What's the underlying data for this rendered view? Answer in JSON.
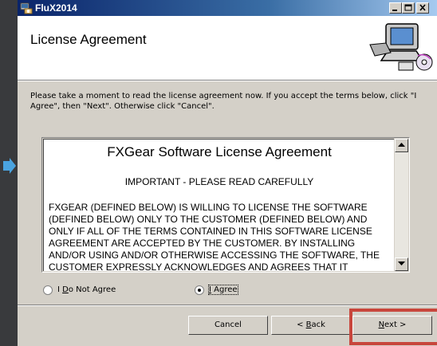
{
  "window": {
    "title": "FluX2014"
  },
  "header": {
    "title": "License Agreement"
  },
  "intro": "Please take a moment to read the license agreement now. If you accept the terms below, click \"I Agree\", then \"Next\". Otherwise click \"Cancel\".",
  "license": {
    "heading": "FXGear Software License Agreement",
    "subheading": "IMPORTANT - PLEASE READ CAREFULLY",
    "body": "FXGEAR (DEFINED BELOW) IS WILLING TO LICENSE THE SOFTWARE (DEFINED BELOW) ONLY TO THE CUSTOMER (DEFINED BELOW) AND ONLY IF ALL OF THE TERMS CONTAINED IN THIS SOFTWARE LICENSE AGREEMENT ARE ACCEPTED BY THE CUSTOMER. BY INSTALLING AND/OR USING AND/OR OTHERWISE ACCESSING THE SOFTWARE, THE CUSTOMER EXPRESSLY ACKNOWLEDGES AND AGREES THAT IT"
  },
  "options": {
    "not_agree": {
      "prefix": "I ",
      "mnemonic": "D",
      "rest": "o Not Agree"
    },
    "agree": {
      "mnemonic": "I",
      "rest": " Agree"
    },
    "selected": "agree"
  },
  "buttons": {
    "cancel": "Cancel",
    "back": {
      "prefix": "< ",
      "mnemonic": "B",
      "rest": "ack"
    },
    "next": {
      "mnemonic": "N",
      "rest": "ext >"
    }
  },
  "colors": {
    "title_bar_start": "#0a246a",
    "title_bar_end": "#a6caf0",
    "highlight": "#c8463c",
    "dialog_bg": "#d4d0c8"
  },
  "icons": [
    "setup-app-icon",
    "minimize-icon",
    "maximize-icon",
    "close-icon",
    "computer-install-graphic",
    "scroll-up-icon",
    "scroll-down-icon",
    "blue-arrow-icon"
  ]
}
